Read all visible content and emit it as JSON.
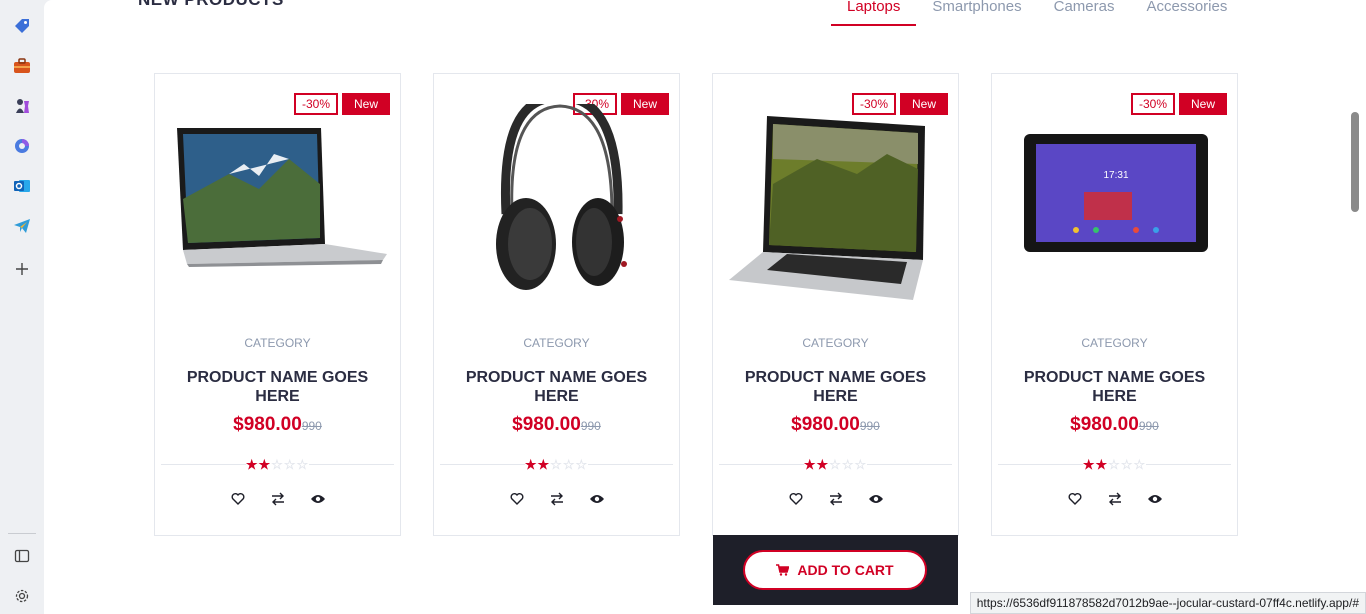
{
  "sidebar": {
    "icons": [
      "tag-icon",
      "briefcase-icon",
      "chess-icon",
      "copilot-icon",
      "outlook-icon",
      "telegram-icon",
      "add-icon",
      "sidebar-toggle-icon",
      "settings-icon"
    ]
  },
  "section": {
    "title": "NEW PRODUCTS"
  },
  "tabs": [
    {
      "label": "Laptops",
      "active": true
    },
    {
      "label": "Smartphones",
      "active": false
    },
    {
      "label": "Cameras",
      "active": false
    },
    {
      "label": "Accessories",
      "active": false
    }
  ],
  "products": [
    {
      "sale": "-30%",
      "new": "New",
      "category": "CATEGORY",
      "name": "PRODUCT NAME GOES HERE",
      "price": "$980.00",
      "old_price": "990",
      "rating": 2,
      "max_rating": 5,
      "image": "laptop-icon"
    },
    {
      "sale": "-30%",
      "new": "New",
      "category": "CATEGORY",
      "name": "PRODUCT NAME GOES HERE",
      "price": "$980.00",
      "old_price": "990",
      "rating": 2,
      "max_rating": 5,
      "image": "headphones-icon"
    },
    {
      "sale": "-30%",
      "new": "New",
      "category": "CATEGORY",
      "name": "PRODUCT NAME GOES HERE",
      "price": "$980.00",
      "old_price": "990",
      "rating": 2,
      "max_rating": 5,
      "image": "laptop-icon"
    },
    {
      "sale": "-30%",
      "new": "New",
      "category": "CATEGORY",
      "name": "PRODUCT NAME GOES HERE",
      "price": "$980.00",
      "old_price": "990",
      "rating": 2,
      "max_rating": 5,
      "image": "tablet-icon"
    }
  ],
  "add_to_cart": {
    "label": "ADD TO CART"
  },
  "status_bar": {
    "url": "https://6536df911878582d7012b9ae--jocular-custard-07ff4c.netlify.app/#"
  },
  "colors": {
    "accent": "#D10024",
    "dark": "#1e1f29",
    "muted": "#8d99ae",
    "text": "#2b2d42"
  }
}
